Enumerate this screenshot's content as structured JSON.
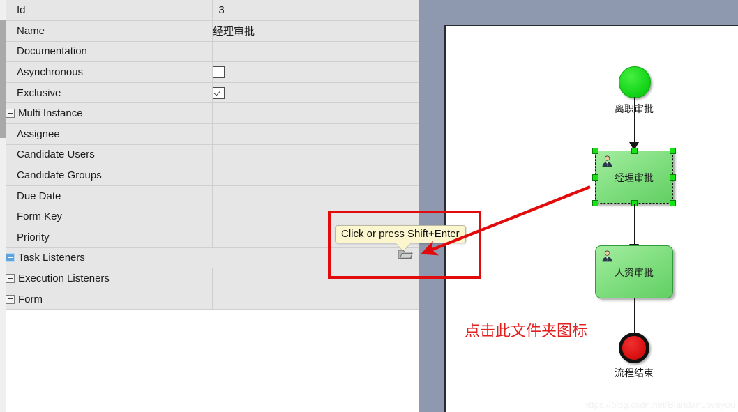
{
  "properties_panel": {
    "rows": [
      {
        "label": "Id",
        "expander": "none",
        "value_type": "text",
        "value": "_3"
      },
      {
        "label": "Name",
        "expander": "none",
        "value_type": "text",
        "value": "经理审批"
      },
      {
        "label": "Documentation",
        "expander": "none",
        "value_type": "empty",
        "value": ""
      },
      {
        "label": "Asynchronous",
        "expander": "none",
        "value_type": "checkbox",
        "value": "unchecked"
      },
      {
        "label": "Exclusive",
        "expander": "none",
        "value_type": "checkbox",
        "value": "checked"
      },
      {
        "label": "Multi Instance",
        "expander": "plus",
        "value_type": "empty",
        "value": ""
      },
      {
        "label": "Assignee",
        "expander": "none",
        "value_type": "empty",
        "value": ""
      },
      {
        "label": "Candidate Users",
        "expander": "none",
        "value_type": "empty",
        "value": ""
      },
      {
        "label": "Candidate Groups",
        "expander": "none",
        "value_type": "empty",
        "value": ""
      },
      {
        "label": "Due Date",
        "expander": "none",
        "value_type": "empty",
        "value": ""
      },
      {
        "label": "Form Key",
        "expander": "none",
        "value_type": "empty",
        "value": ""
      },
      {
        "label": "Priority",
        "expander": "none",
        "value_type": "empty",
        "value": ""
      },
      {
        "label": "Task Listeners",
        "expander": "minus",
        "value_type": "folder",
        "value": "",
        "selected": true
      },
      {
        "label": "Execution Listeners",
        "expander": "plus",
        "value_type": "empty",
        "value": ""
      },
      {
        "label": "Form",
        "expander": "plus",
        "value_type": "empty",
        "value": ""
      }
    ],
    "selection_color": "#1378cc",
    "row_background": "#e6e6e6"
  },
  "tooltip": {
    "text": "Click or press Shift+Enter",
    "background": "#fbf6cd"
  },
  "annotation": {
    "note_text": "点击此文件夹图标",
    "highlight_color": "#e20b0b"
  },
  "diagram": {
    "start_event": {
      "caption": "离职审批",
      "color": "#15d61b"
    },
    "tasks": [
      {
        "label": "经理审批",
        "selected": true
      },
      {
        "label": "人资审批",
        "selected": false
      }
    ],
    "end_event": {
      "caption": "流程结束",
      "color": "#da1111"
    },
    "canvas_background": "#ffffff",
    "editor_background": "#8e99b0"
  },
  "watermark": {
    "text": "https://blog.csdn.net/BiandanLoveyou"
  }
}
